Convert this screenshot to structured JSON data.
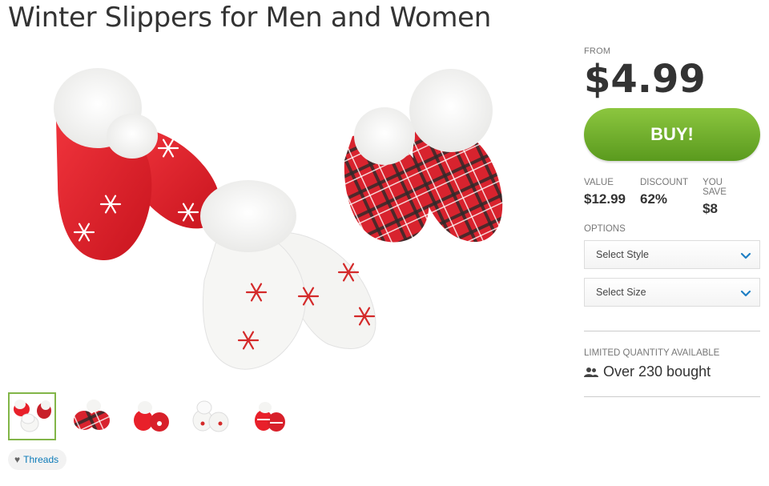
{
  "title": "Winter Slippers for Men and Women",
  "pricing": {
    "from_label": "FROM",
    "price": "$4.99",
    "buy_label": "BUY!",
    "value_label": "VALUE",
    "value": "$12.99",
    "discount_label": "DISCOUNT",
    "discount": "62%",
    "save_label": "YOU SAVE",
    "save": "$8"
  },
  "options": {
    "label": "OPTIONS",
    "style_select": "Select Style",
    "size_select": "Select Size"
  },
  "availability": {
    "label": "LIMITED QUANTITY AVAILABLE",
    "bought": "Over 230 bought"
  },
  "threads_label": "Threads",
  "colors": {
    "buy_green": "#6bab2c",
    "thumb_active": "#82b548",
    "slipper_red": "#e8202a",
    "link_blue": "#0b7ab8"
  },
  "icons": [
    "chevron-down-icon",
    "users-icon",
    "heart-icon"
  ]
}
